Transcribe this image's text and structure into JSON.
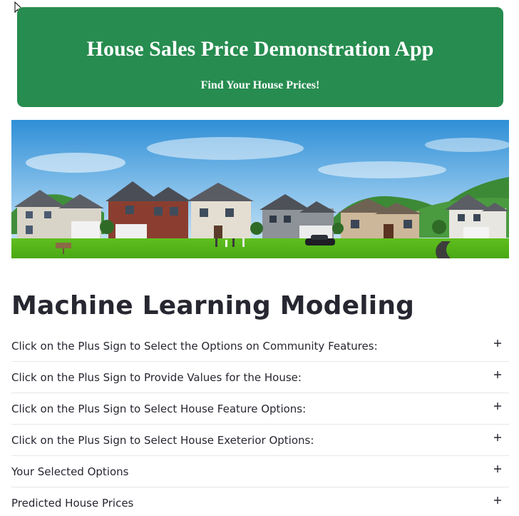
{
  "header": {
    "title": "House Sales Price Demonstration App",
    "subtitle": "Find Your House Prices!",
    "background_color": "#268c4f"
  },
  "banner": {
    "image": "suburban-houses-banner"
  },
  "main": {
    "section_title": "Machine Learning Modeling",
    "expanders": [
      {
        "label": "Click on the Plus Sign to Select the Options on Community Features:",
        "icon": "plus-icon"
      },
      {
        "label": "Click on the Plus Sign to Provide Values for the House:",
        "icon": "plus-icon"
      },
      {
        "label": "Click on the Plus Sign to Select House Feature Options:",
        "icon": "plus-icon"
      },
      {
        "label": "Click on the Plus Sign to Select House Exeterior Options:",
        "icon": "plus-icon"
      },
      {
        "label": "Your Selected Options",
        "icon": "plus-icon"
      },
      {
        "label": "Predicted House Prices",
        "icon": "plus-icon"
      }
    ]
  }
}
